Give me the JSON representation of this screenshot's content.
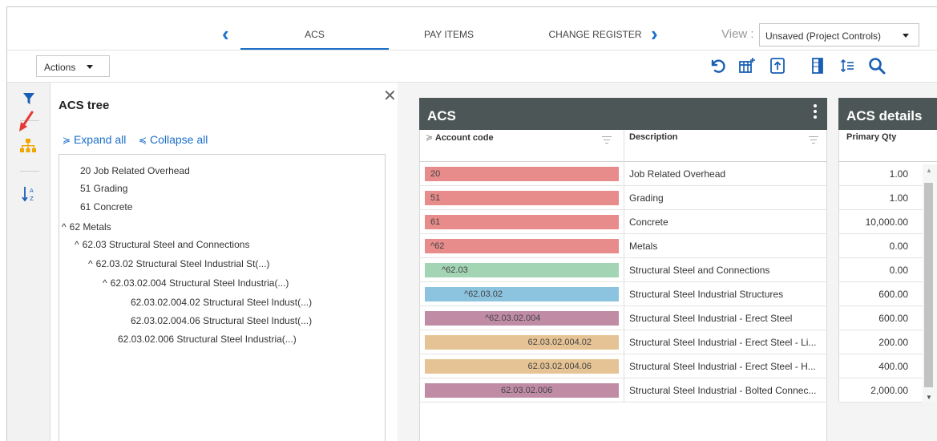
{
  "tabs": {
    "items": [
      "ACS",
      "PAY ITEMS",
      "CHANGE REGISTER"
    ],
    "active": "ACS"
  },
  "view": {
    "label": "View :",
    "selected": "Unsaved (Project Controls)"
  },
  "toolbar": {
    "actions_label": "Actions",
    "icons": [
      "undo-icon",
      "add-column-icon",
      "export-icon",
      "column-panel-icon",
      "row-height-icon",
      "search-icon"
    ]
  },
  "rail": {
    "icons": [
      "filter-icon",
      "hierarchy-icon",
      "sort-az-icon"
    ]
  },
  "tree": {
    "title": "ACS tree",
    "expand_all": "Expand all",
    "collapse_all": "Collapse all",
    "rows": [
      {
        "caret": "",
        "text": "20 Job Related Overhead"
      },
      {
        "caret": "",
        "text": "51 Grading"
      },
      {
        "caret": "",
        "text": "61 Concrete"
      },
      {
        "caret": "^",
        "text": "62 Metals"
      },
      {
        "caret": "^",
        "text": "62.03 Structural Steel and Connections"
      },
      {
        "caret": "^",
        "text": "62.03.02 Structural Steel Industrial St(...)"
      },
      {
        "caret": "^",
        "text": "62.03.02.004 Structural Steel Industria(...)"
      },
      {
        "caret": "",
        "text": "62.03.02.004.02 Structural Steel Indust(...)"
      },
      {
        "caret": "",
        "text": "62.03.02.004.06 Structural Steel Indust(...)"
      },
      {
        "caret": "",
        "text": "62.03.02.006 Structural Steel Industria(...)"
      }
    ]
  },
  "grid": {
    "title": "ACS",
    "col_account": "Account code",
    "col_description": "Description",
    "rows": [
      {
        "code": "20",
        "caret": "",
        "color": "#e78b8b",
        "description": "Job Related Overhead"
      },
      {
        "code": "51",
        "caret": "",
        "color": "#e78b8b",
        "description": "Grading"
      },
      {
        "code": "61",
        "caret": "",
        "color": "#e78b8b",
        "description": "Concrete"
      },
      {
        "code": "62",
        "caret": "^",
        "color": "#e78b8b",
        "description": "Metals"
      },
      {
        "code": "62.03",
        "caret": "^",
        "color": "#a3d4b4",
        "description": "Structural Steel and Connections"
      },
      {
        "code": "62.03.02",
        "caret": "^",
        "color": "#8cc4e0",
        "description": "Structural Steel Industrial Structures"
      },
      {
        "code": "62.03.02.004",
        "caret": "^",
        "color": "#c08ca5",
        "description": "Structural Steel Industrial - Erect Steel"
      },
      {
        "code": "62.03.02.004.02",
        "caret": "",
        "color": "#e6c394",
        "description": "Structural Steel Industrial - Erect Steel - Li..."
      },
      {
        "code": "62.03.02.004.06",
        "caret": "",
        "color": "#e6c394",
        "description": "Structural Steel Industrial - Erect Steel - H..."
      },
      {
        "code": "62.03.02.006",
        "caret": "",
        "color": "#c08ca5",
        "description": "Structural Steel Industrial - Bolted Connec..."
      }
    ]
  },
  "details": {
    "title": "ACS details",
    "col_primary_qty": "Primary Qty",
    "values": [
      "1.00",
      "1.00",
      "10,000.00",
      "0.00",
      "0.00",
      "600.00",
      "600.00",
      "200.00",
      "400.00",
      "2,000.00"
    ]
  },
  "colors": {
    "accent": "#1a6fc9",
    "header_bg": "#4d5656",
    "hierarchy_icon": "#f0a500",
    "annotation_arrow": "#e53935"
  }
}
